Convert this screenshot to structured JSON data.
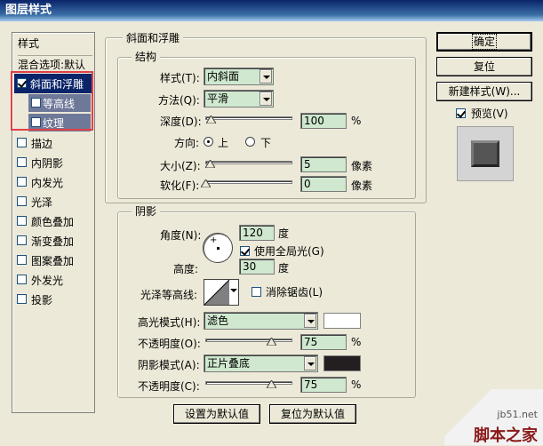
{
  "window": {
    "title": "图层样式"
  },
  "sidebar": {
    "header": "样式",
    "blend_options": "混合选项:默认",
    "items": [
      {
        "label": "斜面和浮雕",
        "checked": true,
        "selected": true
      },
      {
        "label": "等高线",
        "checked": false,
        "sub": true
      },
      {
        "label": "纹理",
        "checked": false,
        "sub": true
      },
      {
        "label": "描边",
        "checked": false
      },
      {
        "label": "内阴影",
        "checked": false
      },
      {
        "label": "内发光",
        "checked": false
      },
      {
        "label": "光泽",
        "checked": false
      },
      {
        "label": "颜色叠加",
        "checked": false
      },
      {
        "label": "渐变叠加",
        "checked": false
      },
      {
        "label": "图案叠加",
        "checked": false
      },
      {
        "label": "外发光",
        "checked": false
      },
      {
        "label": "投影",
        "checked": false
      }
    ]
  },
  "bevel": {
    "section_title": "斜面和浮雕",
    "structure_title": "结构",
    "style_label": "样式(T):",
    "style_value": "内斜面",
    "technique_label": "方法(Q):",
    "technique_value": "平滑",
    "depth_label": "深度(D):",
    "depth_value": "100",
    "depth_unit": "%",
    "direction_label": "方向:",
    "direction_up": "上",
    "direction_down": "下",
    "size_label": "大小(Z):",
    "size_value": "5",
    "size_unit": "像素",
    "soften_label": "软化(F):",
    "soften_value": "0",
    "soften_unit": "像素"
  },
  "shading": {
    "title": "阴影",
    "angle_label": "角度(N):",
    "angle_value": "120",
    "angle_unit": "度",
    "global_light_label": "使用全局光(G)",
    "global_light_checked": true,
    "altitude_label": "高度:",
    "altitude_value": "30",
    "altitude_unit": "度",
    "gloss_label": "光泽等高线:",
    "antialias_label": "消除锯齿(L)",
    "highlight_mode_label": "高光模式(H):",
    "highlight_mode_value": "滤色",
    "highlight_color": "#FFFFFF",
    "highlight_opacity_label": "不透明度(O):",
    "highlight_opacity_value": "75",
    "highlight_opacity_unit": "%",
    "shadow_mode_label": "阴影模式(A):",
    "shadow_mode_value": "正片叠底",
    "shadow_color": "#231F20",
    "shadow_opacity_label": "不透明度(C):",
    "shadow_opacity_value": "75",
    "shadow_opacity_unit": "%"
  },
  "footer": {
    "set_default": "设置为默认值",
    "reset_default": "复位为默认值"
  },
  "actions": {
    "ok": "确定",
    "reset": "复位",
    "new_style": "新建样式(W)...",
    "preview_label": "预览(V)",
    "preview_checked": true
  },
  "watermark": {
    "site": "jb51.net",
    "brand": "脚本之家"
  }
}
